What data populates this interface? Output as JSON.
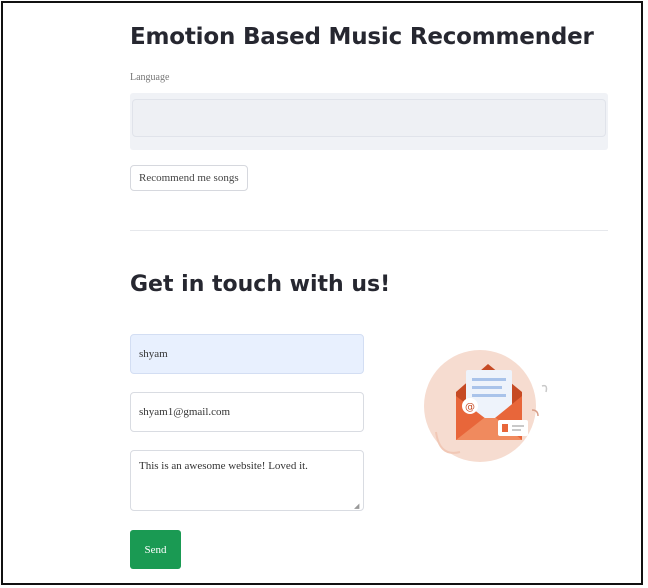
{
  "app": {
    "title": "Emotion Based Music Recommender"
  },
  "language": {
    "label": "Language",
    "value": ""
  },
  "recommend_button": {
    "label": "Recommend me songs"
  },
  "contact": {
    "heading": "Get in touch with us!",
    "name_value": "shyam",
    "email_value": "shyam1@gmail.com",
    "message_value": "This is an awesome website! Loved it.",
    "send_label": "Send"
  },
  "colors": {
    "send_button": "#1a9a53",
    "autofill_bg": "#e8f0fe",
    "illustration_bg": "#f6d9cc",
    "envelope": "#e8663a"
  },
  "icons": {
    "illustration": "envelope-mail-icon"
  }
}
